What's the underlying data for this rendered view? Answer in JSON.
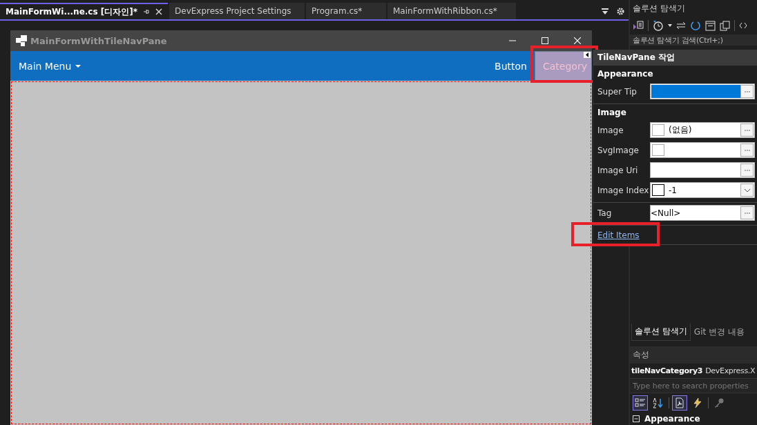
{
  "doc_tabs": [
    {
      "label": "MainFormWi...ne.cs [디자인]*",
      "selected": true
    },
    {
      "label": "DevExpress Project Settings",
      "selected": false
    },
    {
      "label": "Program.cs*",
      "selected": false
    },
    {
      "label": "MainFormWithRibbon.cs*",
      "selected": false
    }
  ],
  "form": {
    "title": "MainFormWithTileNavPane",
    "main_menu": "Main Menu",
    "nav_items": [
      {
        "label": "Button",
        "selected": false,
        "highlighted": false
      },
      {
        "label": "Category",
        "selected": true,
        "highlighted": true
      }
    ]
  },
  "smart_tag": {
    "title": "TileNavPane 작업",
    "sections": [
      {
        "title": "Appearance",
        "rows": [
          {
            "label": "Super Tip",
            "kind": "text",
            "selected": true
          }
        ]
      },
      {
        "title": "Image",
        "rows": [
          {
            "label": "Image",
            "kind": "image",
            "value": "(없음)",
            "selected": false
          },
          {
            "label": "SvgImage",
            "kind": "image",
            "selected": false
          },
          {
            "label": "Image Uri",
            "kind": "text",
            "selected": false
          },
          {
            "label": "Image Index",
            "kind": "index",
            "value": "-1",
            "selected": false
          }
        ]
      },
      {
        "rows": [
          {
            "label": "Tag",
            "kind": "text",
            "value": "<Null>",
            "selected": false
          }
        ]
      }
    ],
    "link": {
      "label": "Edit Items",
      "highlighted": true
    }
  },
  "solution_explorer": {
    "title": "솔루션 탐색기",
    "search_placeholder": "솔루션 탐색기 검색(Ctrl+;)",
    "tabs": [
      {
        "label": "솔루션 탐색기",
        "selected": true
      },
      {
        "label": "Git 변경 내용",
        "selected": false
      }
    ]
  },
  "properties": {
    "title": "속성",
    "object_name": "tileNavCategory3",
    "object_type": "DevExpress.X",
    "search_placeholder": "Type here to search properties",
    "toolbar": [
      {
        "kind": "categorized",
        "selected": true
      },
      {
        "kind": "alphabetical",
        "selected": false
      },
      {
        "kind": "properties",
        "selected": true
      },
      {
        "kind": "events",
        "selected": false
      },
      {
        "kind": "pages",
        "selected": false
      }
    ],
    "category": "Appearance"
  }
}
